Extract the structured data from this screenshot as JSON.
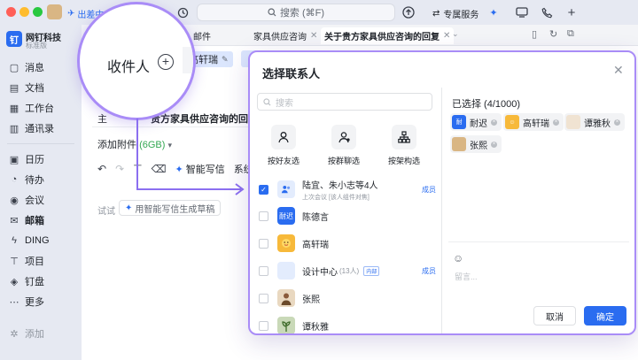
{
  "window": {
    "titlebar": {
      "user_label": "出差中",
      "search_placeholder": "搜索 (⌘F)",
      "service_label": "专属服务"
    }
  },
  "sidebar": {
    "brand_name": "网钉科技",
    "brand_sub": "标准版",
    "logo_glyph": "钉",
    "items": [
      {
        "label": "消息",
        "icon": "message-icon"
      },
      {
        "label": "文档",
        "icon": "doc-icon"
      },
      {
        "label": "工作台",
        "icon": "workbench-icon"
      },
      {
        "label": "通讯录",
        "icon": "contacts-icon"
      },
      {
        "label": "日历",
        "icon": "calendar-icon"
      },
      {
        "label": "待办",
        "icon": "todo-icon"
      },
      {
        "label": "会议",
        "icon": "meeting-icon"
      },
      {
        "label": "邮箱",
        "icon": "mail-icon",
        "active": true
      },
      {
        "label": "DING",
        "icon": "ding-icon"
      },
      {
        "label": "项目",
        "icon": "project-icon"
      },
      {
        "label": "钉盘",
        "icon": "drive-icon"
      },
      {
        "label": "更多",
        "icon": "more-icon"
      }
    ],
    "add_label": "添加"
  },
  "compose": {
    "tabs": [
      "邮件",
      "家具供应咨询",
      "关于贵方家具供应咨询的回复"
    ],
    "recipient_chip": "高轩瑞",
    "subject_label": "主",
    "subject_text": "贵方家具供应咨询的回复",
    "attach_label": "添加附件",
    "attach_size": "(6GB)",
    "ai_write": "智能写信",
    "sys_text": "系统",
    "try_label": "试试",
    "ai_draft": "用智能写信生成草稿"
  },
  "magnifier": {
    "label": "收件人"
  },
  "dialog": {
    "title": "选择联系人",
    "search_placeholder": "搜索",
    "pick_options": [
      "按好友选",
      "按群聊选",
      "按架构选"
    ],
    "contacts": [
      {
        "name": "陆宜、朱小志等4人",
        "sub": "上次会议 [该人组件对焦]",
        "tag": "成员",
        "checked": true,
        "avatar_color": "#e3ecfd",
        "avatar_text": ""
      },
      {
        "name": "陈德言",
        "sub": "",
        "tag": "",
        "checked": false,
        "avatar_color": "#2a6cf0",
        "avatar_text": "耐迟"
      },
      {
        "name": "高轩瑞",
        "sub": "",
        "tag": "",
        "checked": false,
        "avatar_color": "#f7b93a",
        "avatar_text": ""
      },
      {
        "name": "设计中心",
        "count": "(13人)",
        "inner": "内部",
        "sub": "",
        "tag": "成员",
        "checked": false,
        "avatar_color": "#6b8fe8",
        "avatar_text": ""
      },
      {
        "name": "张熙",
        "sub": "",
        "tag": "",
        "checked": false,
        "avatar_color": "#d9b684",
        "avatar_text": ""
      },
      {
        "name": "谭秋雅",
        "sub": "",
        "tag": "",
        "checked": false,
        "avatar_color": "#7fa56b",
        "avatar_text": ""
      }
    ],
    "selected_title": "已选择 (4/1000)",
    "selected": [
      {
        "name": "耐迟",
        "avatar_color": "#2a6cf0",
        "avatar_text": "耐迟"
      },
      {
        "name": "高轩瑞",
        "avatar_color": "#f7b93a",
        "avatar_text": ""
      },
      {
        "name": "谭雅秋",
        "avatar_color": "#f0e3d2",
        "avatar_text": ""
      },
      {
        "name": "张熙",
        "avatar_color": "#d9b684",
        "avatar_text": ""
      }
    ],
    "message_placeholder": "留言...",
    "cancel_label": "取消",
    "confirm_label": "确定"
  },
  "colors": {
    "accent": "#2a6cf0",
    "highlight_outline": "#a98cf7"
  }
}
